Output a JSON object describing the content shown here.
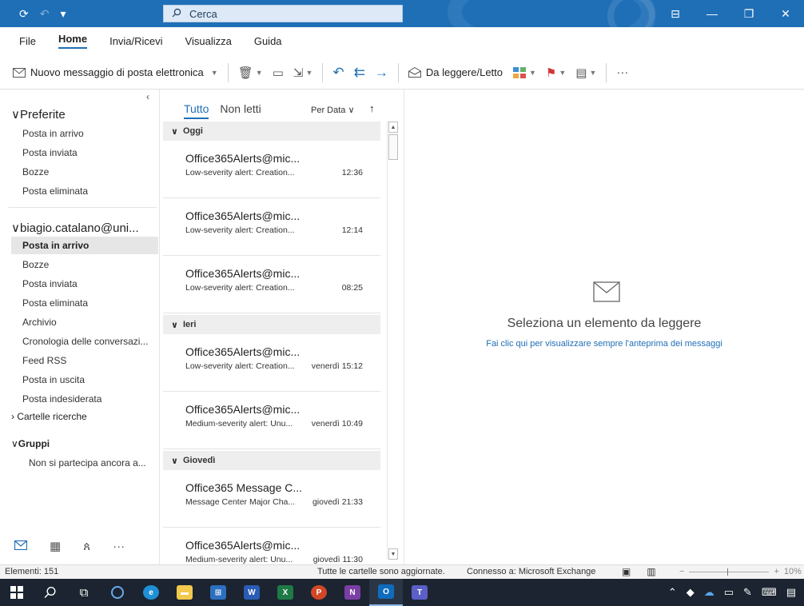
{
  "title_bar": {
    "search_placeholder": "Cerca",
    "icons": [
      "sync-icon",
      "undo-icon",
      "customize-icon",
      "ribbon-icon",
      "minimize-icon",
      "restore-icon",
      "close-icon"
    ]
  },
  "menu": {
    "tabs": [
      "File",
      "Home",
      "Invia/Ricevi",
      "Visualizza",
      "Guida"
    ],
    "active": "Home"
  },
  "ribbon": {
    "new_message": "Nuovo messaggio di posta elettronica",
    "read_unread": "Da leggere/Letto",
    "more": "···"
  },
  "folders": {
    "favorites_label": "Preferite",
    "favorites": [
      "Posta in arrivo",
      "Posta inviata",
      "Bozze",
      "Posta eliminata"
    ],
    "account_label": "biagio.catalano@uni...",
    "account_items": [
      "Posta in arrivo",
      "Bozze",
      "Posta inviata",
      "Posta eliminata",
      "Archivio",
      "Cronologia delle conversazi...",
      "Feed RSS",
      "Posta in uscita",
      "Posta indesiderata"
    ],
    "selected": "Posta in arrivo",
    "searches_label": "Cartelle ricerche",
    "groups_label": "Gruppi",
    "groups_item": "Non si partecipa ancora a..."
  },
  "list": {
    "tab_all": "Tutto",
    "tab_unread": "Non letti",
    "sort_label": "Per Data",
    "groups": [
      {
        "label": "Oggi",
        "messages": [
          {
            "sender": "Office365Alerts@mic...",
            "subject": "Low-severity alert: Creation...",
            "time": "12:36"
          },
          {
            "sender": "Office365Alerts@mic...",
            "subject": "Low-severity alert: Creation...",
            "time": "12:14"
          },
          {
            "sender": "Office365Alerts@mic...",
            "subject": "Low-severity alert: Creation...",
            "time": "08:25"
          }
        ]
      },
      {
        "label": "Ieri",
        "messages": [
          {
            "sender": "Office365Alerts@mic...",
            "subject": "Low-severity alert: Creation...",
            "time": "venerdì 15:12"
          },
          {
            "sender": "Office365Alerts@mic...",
            "subject": "Medium-severity alert: Unu...",
            "time": "venerdì 10:49"
          }
        ]
      },
      {
        "label": "Giovedì",
        "messages": [
          {
            "sender": "Office365 Message C...",
            "subject": "Message Center Major Cha...",
            "time": "giovedì 21:33"
          },
          {
            "sender": "Office365Alerts@mic...",
            "subject": "Medium-severity alert: Unu...",
            "time": "giovedì 11:30"
          }
        ]
      }
    ]
  },
  "reading": {
    "title": "Seleziona un elemento da leggere",
    "link": "Fai clic qui per visualizzare sempre l'anteprima dei messaggi"
  },
  "status": {
    "items": "Elementi: 151",
    "sync": "Tutte le cartelle sono aggiornate.",
    "connection": "Connesso a: Microsoft Exchange",
    "zoom": "10%"
  },
  "colors": {
    "accent": "#1f6fb7",
    "titlebar": "#1f6fb7",
    "taskbar": "#1b2430",
    "selection": "#e6e6e6"
  }
}
